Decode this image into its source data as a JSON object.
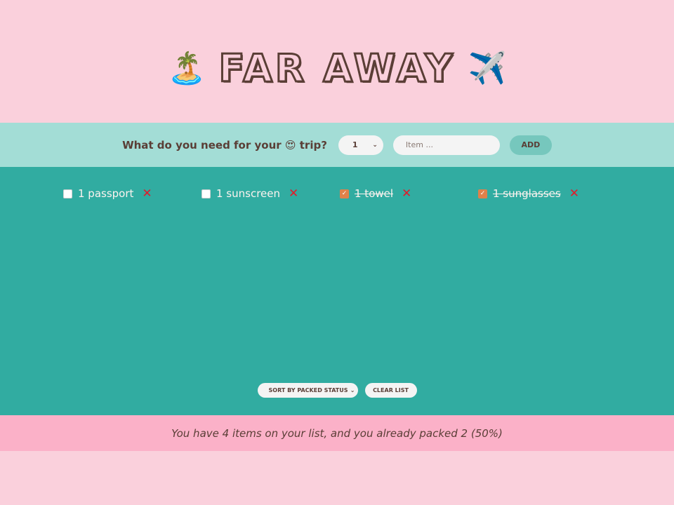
{
  "header": {
    "left_emoji": "🏝️",
    "title": "FAR AWAY",
    "right_emoji": "✈️"
  },
  "form": {
    "question_prefix": "What do you need for your",
    "question_emoji": "😍",
    "question_suffix": "trip?",
    "quantity_selected": "1",
    "item_placeholder": "Item ...",
    "add_label": "ADD"
  },
  "items": [
    {
      "label": "1 passport",
      "packed": false
    },
    {
      "label": "1 sunscreen",
      "packed": false
    },
    {
      "label": "1 towel",
      "packed": true
    },
    {
      "label": "1 sunglasses",
      "packed": true
    }
  ],
  "actions": {
    "sort_selected": "SORT BY PACKED STATUS",
    "clear_label": "CLEAR LIST"
  },
  "stats": {
    "message": "You have 4 items on your list, and you already packed 2 (50%)"
  },
  "colors": {
    "background": "#fad0dc",
    "form_bg": "#a3ddd6",
    "list_bg": "#31aca1",
    "stats_bg": "#fbb1c8",
    "checkbox_checked": "#e0814a",
    "delete": "#e21b2a"
  },
  "icons": {
    "delete": "close-icon",
    "dropdown": "chevron-down-icon"
  }
}
